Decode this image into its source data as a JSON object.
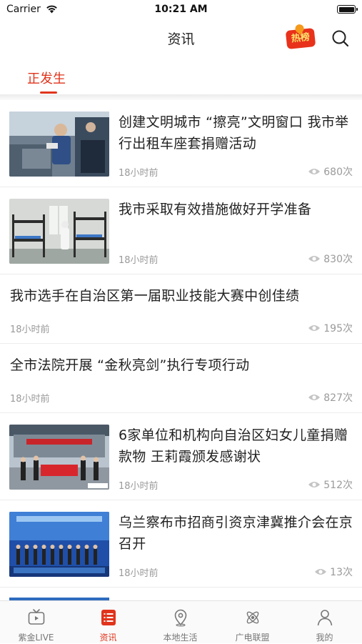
{
  "status_bar": {
    "carrier": "Carrier",
    "time": "10:21 AM"
  },
  "nav": {
    "title": "资讯",
    "hot_badge": "热榜"
  },
  "tabs": {
    "active": "正发生"
  },
  "news": [
    {
      "title": "创建文明城市 “擦亮”文明窗口 我市举行出租车座套捐赠活动",
      "time": "18小时前",
      "views": "680次",
      "has_image": true
    },
    {
      "title": "我市采取有效措施做好开学准备",
      "time": "18小时前",
      "views": "830次",
      "has_image": true
    },
    {
      "title": "我市选手在自治区第一届职业技能大赛中创佳绩",
      "time": "18小时前",
      "views": "195次",
      "has_image": false
    },
    {
      "title": "全市法院开展 “金秋亮剑”执行专项行动",
      "time": "18小时前",
      "views": "827次",
      "has_image": false
    },
    {
      "title": "6家单位和机构向自治区妇女儿童捐赠款物 王莉霞颁发感谢状",
      "time": "18小时前",
      "views": "512次",
      "has_image": true
    },
    {
      "title": "乌兰察布市招商引资京津冀推介会在京召开",
      "time": "18小时前",
      "views": "13次",
      "has_image": true
    }
  ],
  "tab_bar": [
    {
      "label": "紫金LIVE",
      "icon": "tv-icon"
    },
    {
      "label": "资讯",
      "icon": "news-list-icon",
      "active": true
    },
    {
      "label": "本地生活",
      "icon": "location-pin-icon"
    },
    {
      "label": "广电联盟",
      "icon": "atom-icon"
    },
    {
      "label": "我的",
      "icon": "person-icon"
    }
  ],
  "colors": {
    "accent": "#e0341c",
    "text": "#222222",
    "meta": "#9a9a9a"
  }
}
